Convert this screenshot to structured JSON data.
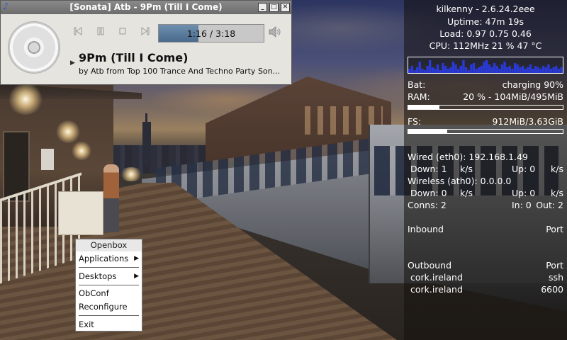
{
  "sonata": {
    "window_title": "[Sonata] Atb - 9Pm (Till I Come)",
    "time_display": "1:16 / 3:18",
    "progress": 0.38,
    "song_title": "9Pm (Till I Come)",
    "song_subtitle": "by Atb from Top 100 Trance And Techno Party Son...",
    "icons": {
      "app": "music-note-icon",
      "minimize": "minimize-icon",
      "maximize": "maximize-icon",
      "close": "close-icon",
      "prev": "previous-track-icon",
      "pause": "pause-icon",
      "stop": "stop-icon",
      "next": "next-track-icon",
      "volume": "volume-icon",
      "album": "cd-album-art",
      "expander": "expander-arrow-icon"
    }
  },
  "conky": {
    "hostname": "kilkenny - 2.6.24.2eee",
    "uptime": "Uptime: 47m 19s",
    "load": "Load: 0.97 0.75 0.46",
    "cpu": "CPU: 112MHz 21 % 47  °C",
    "bat_label": "Bat:",
    "bat_value": "charging 90%",
    "ram_label": "RAM:",
    "ram_value": "20 % - 104MiB/495MiB",
    "ram_fraction": 0.2,
    "fs_label": "FS:",
    "fs_value": "912MiB/3.63GiB",
    "fs_fraction": 0.25,
    "wired_label": "Wired (eth0): 192.168.1.49",
    "wired_down": "Down: 1",
    "wired_down_unit": "k/s",
    "wired_up": "Up: 0",
    "wired_up_unit": "k/s",
    "wireless_label": "Wireless (ath0): 0.0.0.0",
    "wireless_down": "Down: 0",
    "wireless_down_unit": "k/s",
    "wireless_up": "Up: 0",
    "wireless_up_unit": "k/s",
    "conns": "Conns: 2",
    "conns_in": "In: 0",
    "conns_out": "Out: 2",
    "inbound_label": "Inbound",
    "inbound_port_label": "Port",
    "outbound_label": "Outbound",
    "outbound_port_label": "Port",
    "outbound_rows": [
      {
        "host": "cork.ireland",
        "port": "ssh"
      },
      {
        "host": "cork.ireland",
        "port": "6600"
      }
    ],
    "cpu_graph": [
      0.3,
      0.5,
      0.2,
      0.4,
      0.8,
      0.3,
      0.2,
      0.5,
      0.9,
      0.4,
      0.3,
      0.6,
      0.2,
      0.7,
      0.5,
      0.3,
      0.4,
      0.8,
      0.6,
      0.3,
      0.5,
      0.9,
      0.4,
      0.2,
      0.6,
      0.7,
      0.3,
      0.4,
      0.5,
      0.8,
      0.9,
      0.6,
      0.4,
      0.7,
      0.5,
      0.3,
      0.6,
      0.8,
      0.4,
      0.5,
      0.3,
      0.7,
      0.6,
      0.4,
      0.5,
      0.3,
      0.4,
      0.6,
      0.3,
      0.5,
      0.4,
      0.3,
      0.5,
      0.4,
      0.6,
      0.3,
      0.4,
      0.5,
      0.3,
      0.4
    ]
  },
  "openbox_menu": {
    "header": "Openbox",
    "items": {
      "applications": "Applications",
      "desktops": "Desktops",
      "obconf": "ObConf",
      "reconfigure": "Reconfigure",
      "exit": "Exit"
    },
    "submenu_icon": "submenu-arrow-icon"
  },
  "colors": {
    "progress_fill": "#4a6a8c",
    "graph_line": "#2a3ad8",
    "conky_text": "#ffffff"
  }
}
